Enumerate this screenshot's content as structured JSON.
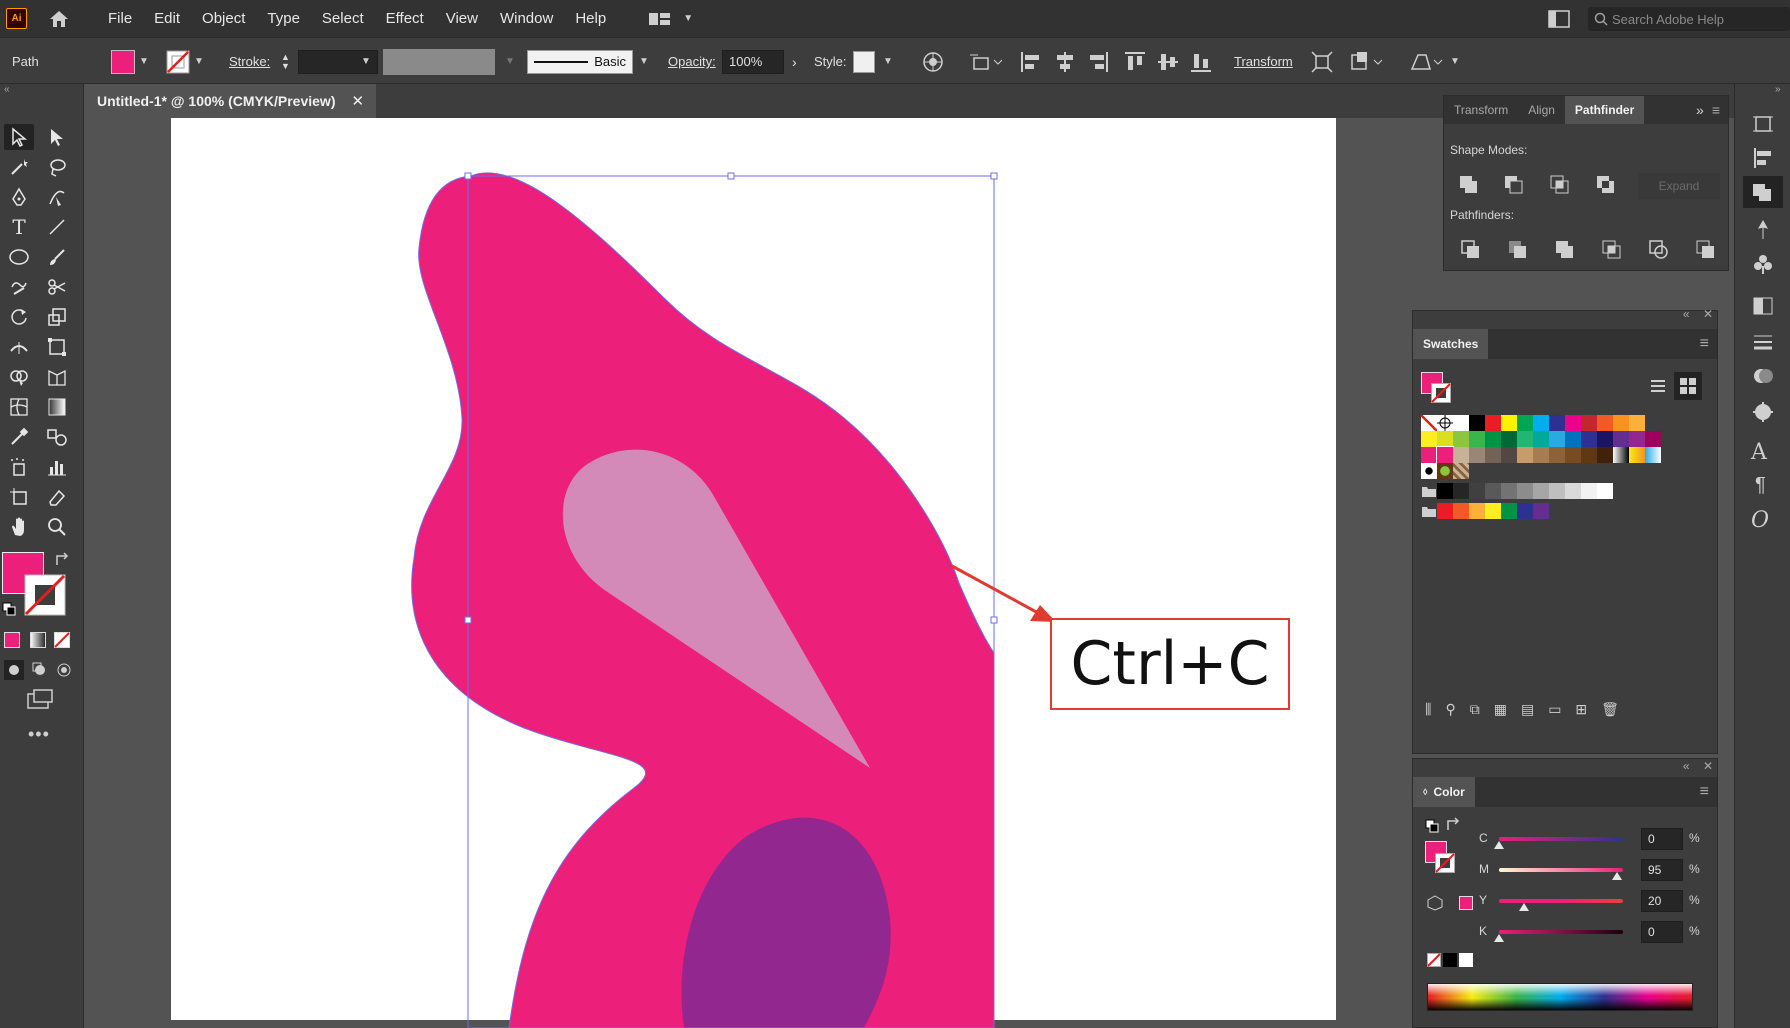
{
  "app": {
    "logo_text": "Ai",
    "menus": [
      "File",
      "Edit",
      "Object",
      "Type",
      "Select",
      "Effect",
      "View",
      "Window",
      "Help"
    ],
    "help_search_placeholder": "Search Adobe Help"
  },
  "control_bar": {
    "selection_type": "Path",
    "stroke_label": "Stroke:",
    "stroke_weight": "",
    "brush_label": "Basic",
    "opacity_label": "Opacity:",
    "opacity_value": "100%",
    "style_label": "Style:",
    "transform_label": "Transform",
    "fill_color": "#ec1f7a"
  },
  "document": {
    "tab_title": "Untitled-1* @ 100% (CMYK/Preview)",
    "close_glyph": "✕"
  },
  "pathfinder_panel": {
    "tabs": [
      "Transform",
      "Align",
      "Pathfinder"
    ],
    "active_tab": "Pathfinder",
    "shape_modes_label": "Shape Modes:",
    "expand_label": "Expand",
    "pathfinders_label": "Pathfinders:"
  },
  "swatches_panel": {
    "title": "Swatches",
    "row1": [
      "none",
      "reg",
      "#ffffff",
      "#000000",
      "#ec1c24",
      "#fff200",
      "#00a651",
      "#00aeef",
      "#2e3192",
      "#ec008c",
      "#c1272d",
      "#f15a24",
      "#f7931e",
      "#fbb03b"
    ],
    "row2": [
      "#fcee21",
      "#d9e021",
      "#8cc63f",
      "#39b54a",
      "#009245",
      "#006837",
      "#22b573",
      "#00a99d",
      "#29abe2",
      "#0071bc",
      "#2e3192",
      "#1b1464",
      "#662d91",
      "#93278f",
      "#9e005d"
    ],
    "row3": [
      "#ec1f7a",
      "#ec1f7a",
      "#c7b299",
      "#998675",
      "#736357",
      "#534741",
      "#c69c6d",
      "#a67c52",
      "#8c6239",
      "#754c24",
      "#603813",
      "#42210b",
      "grad1",
      "grad2",
      "grad3"
    ],
    "row4": [
      "pat1",
      "pat2",
      "pat3"
    ],
    "group1": [
      "#000000",
      "#262626",
      "#404040",
      "#595959",
      "#737373",
      "#8c8c8c",
      "#a6a6a6",
      "#bfbfbf",
      "#d9d9d9",
      "#f2f2f2",
      "#ffffff"
    ],
    "group2": [
      "#ec1c24",
      "#f15a24",
      "#fbb03b",
      "#fcee21",
      "#009245",
      "#2e3192",
      "#662d91"
    ]
  },
  "color_panel": {
    "title": "Color",
    "channels": [
      {
        "label": "C",
        "value": "0",
        "fraction": 0.0,
        "unit": "%"
      },
      {
        "label": "M",
        "value": "95",
        "fraction": 0.95,
        "unit": "%"
      },
      {
        "label": "Y",
        "value": "20",
        "fraction": 0.2,
        "unit": "%"
      },
      {
        "label": "K",
        "value": "0",
        "fraction": 0.0,
        "unit": "%"
      }
    ]
  },
  "annotation": {
    "shortcut": "Ctrl+C"
  },
  "colors": {
    "magenta": "#ec1f7a",
    "light_pink": "#d48ab8",
    "purple": "#92278f",
    "callout_border": "#e03a31"
  }
}
